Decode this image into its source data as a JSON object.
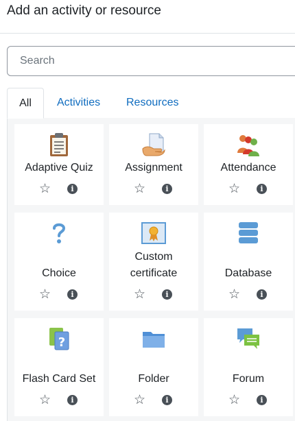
{
  "modal": {
    "title": "Add an activity or resource"
  },
  "search": {
    "placeholder": "Search"
  },
  "tabs": [
    {
      "label": "All",
      "active": true
    },
    {
      "label": "Activities",
      "active": false
    },
    {
      "label": "Resources",
      "active": false
    }
  ],
  "items": [
    {
      "label": "Adaptive Quiz",
      "icon": "clipboard-icon"
    },
    {
      "label": "Assignment",
      "icon": "assignment-icon"
    },
    {
      "label": "Attendance",
      "icon": "people-icon"
    },
    {
      "label": "Choice",
      "icon": "question-mark-icon"
    },
    {
      "label": "Custom certificate",
      "label_lines": [
        "Custom",
        "certificate"
      ],
      "icon": "certificate-icon"
    },
    {
      "label": "Database",
      "icon": "database-icon"
    },
    {
      "label": "Flash Card Set",
      "icon": "flashcard-icon"
    },
    {
      "label": "Folder",
      "icon": "folder-icon"
    },
    {
      "label": "Forum",
      "icon": "forum-icon"
    }
  ],
  "actions": {
    "star_icon": "star-outline-icon",
    "info_icon": "info-icon"
  },
  "colors": {
    "link": "#0f6cbf",
    "text": "#1d2125",
    "panel_bg": "#f5f6f7",
    "icon_blue": "#5b9bd5"
  }
}
